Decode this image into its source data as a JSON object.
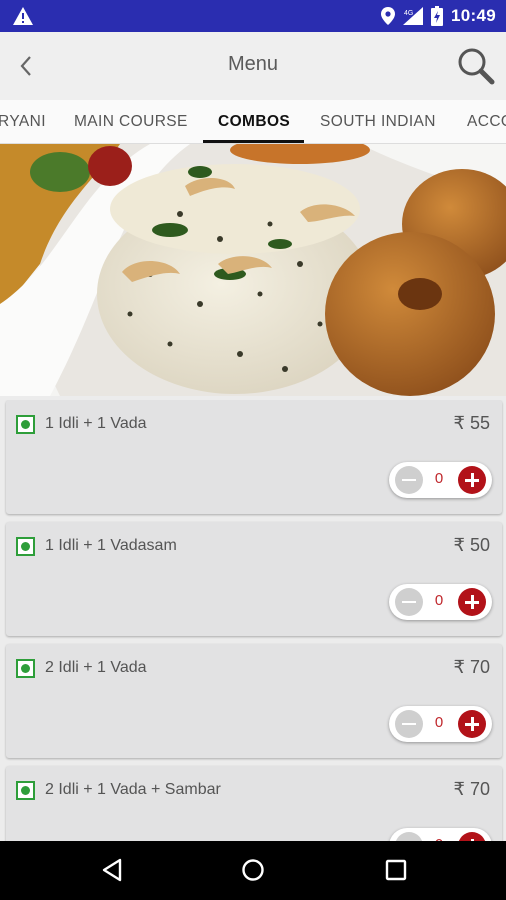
{
  "status_bar": {
    "time": "10:49",
    "icons": [
      "warning-icon",
      "location-icon",
      "signal-icon",
      "battery-icon"
    ]
  },
  "app_bar": {
    "title": "Menu",
    "icons": [
      "back-icon",
      "search-icon"
    ]
  },
  "tabs": [
    {
      "label": "RYANI",
      "active": false
    },
    {
      "label": "MAIN COURSE",
      "active": false
    },
    {
      "label": "COMBOS",
      "active": true
    },
    {
      "label": "SOUTH INDIAN",
      "active": false
    },
    {
      "label": "ACCO",
      "active": false
    }
  ],
  "menu_items": [
    {
      "name": "1 Idli + 1 Vada",
      "price": "₹ 55",
      "quantity": "0"
    },
    {
      "name": "1 Idli + 1 Vadasam",
      "price": "₹ 50",
      "quantity": "0"
    },
    {
      "name": "2 Idli + 1 Vada",
      "price": "₹ 70",
      "quantity": "0"
    },
    {
      "name": "2 Idli + 1 Vada + Sambar",
      "price": "₹ 70",
      "quantity": "0"
    }
  ],
  "colors": {
    "status_bar": "#2a2db0",
    "veg_green": "#2e9e3a",
    "plus_red": "#b21219",
    "qty_red": "#c0282d"
  }
}
